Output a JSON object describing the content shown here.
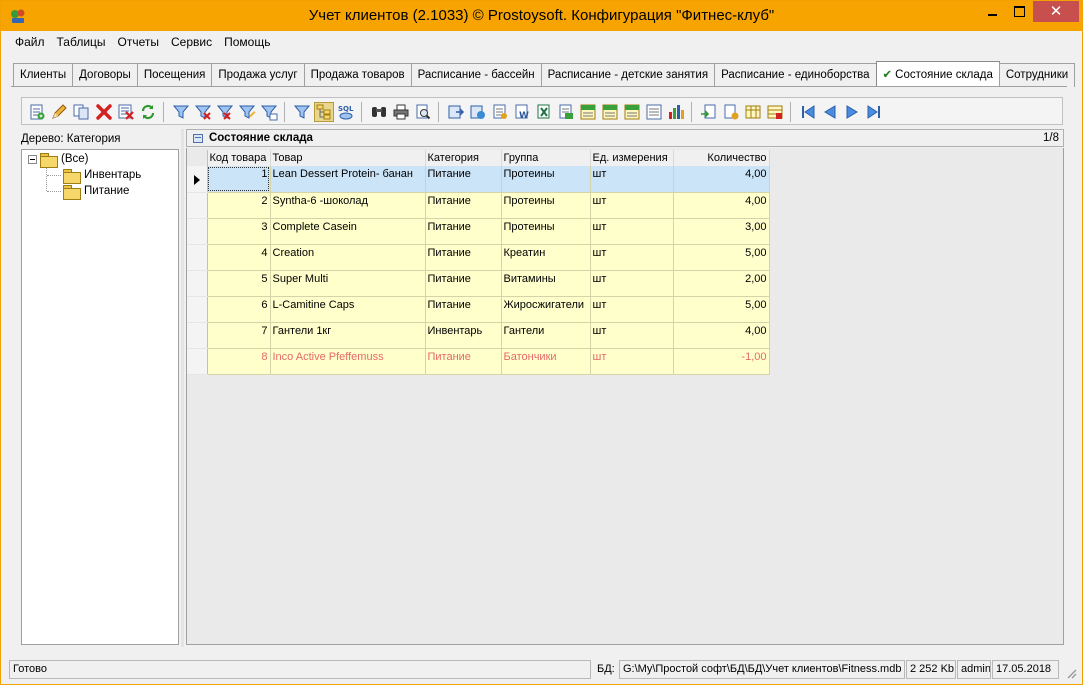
{
  "window": {
    "title": "Учет клиентов (2.1033) © Prostoysoft. Конфигурация \"Фитнес-клуб\"",
    "accent": "#f7a400",
    "close_glyph": "✕"
  },
  "menu": [
    "Файл",
    "Таблицы",
    "Отчеты",
    "Сервис",
    "Помощь"
  ],
  "tabs": [
    {
      "label": "Клиенты",
      "active": false
    },
    {
      "label": "Договоры",
      "active": false
    },
    {
      "label": "Посещения",
      "active": false
    },
    {
      "label": "Продажа услуг",
      "active": false
    },
    {
      "label": "Продажа товаров",
      "active": false
    },
    {
      "label": "Расписание - бассейн",
      "active": false
    },
    {
      "label": "Расписание - детские занятия",
      "active": false
    },
    {
      "label": "Расписание - единоборства",
      "active": false
    },
    {
      "label": "Состояние склада",
      "active": true
    },
    {
      "label": "Сотрудники",
      "active": false
    }
  ],
  "toolbar": {
    "icons": [
      "new-record-icon",
      "edit-icon",
      "copy-icon",
      "delete-icon",
      "delete-all-icon",
      "refresh-icon",
      "filter-icon",
      "filter-remove-icon",
      "filter-clear-icon",
      "filter-edit-icon",
      "filter-apply-icon",
      "view-filter-icon",
      "tree-view-icon",
      "sql-query-icon",
      "find-icon",
      "print-icon",
      "print-preview-icon",
      "export-icon",
      "export-html-icon",
      "export-rtf-icon",
      "export-word-icon",
      "export-excel-icon",
      "export-xml-icon",
      "export-txt-icon",
      "export-csv-icon",
      "export-dbf-icon",
      "chart-icon",
      "import-icon",
      "import-excel-icon",
      "columns-icon",
      "fields-icon",
      "first-record-icon",
      "prev-record-icon",
      "next-record-icon",
      "last-record-icon"
    ]
  },
  "tree": {
    "label": "Дерево: Категория",
    "root": "(Все)",
    "children": [
      "Инвентарь",
      "Питание"
    ]
  },
  "grid": {
    "title": "Состояние склада",
    "position": "1/8",
    "columns": [
      "Код товара",
      "Товар",
      "Категория",
      "Группа",
      "Ед. измерения",
      "Количество"
    ],
    "rows": [
      {
        "id": "1",
        "name": "Lean Dessert Protein- банан",
        "category": "Питание",
        "group": "Протеины",
        "unit": "шт",
        "qty": "4,00"
      },
      {
        "id": "2",
        "name": "Syntha-6 -шоколад",
        "category": "Питание",
        "group": "Протеины",
        "unit": "шт",
        "qty": "4,00"
      },
      {
        "id": "3",
        "name": "Complete Casein",
        "category": "Питание",
        "group": "Протеины",
        "unit": "шт",
        "qty": "3,00"
      },
      {
        "id": "4",
        "name": "Creation",
        "category": "Питание",
        "group": "Креатин",
        "unit": "шт",
        "qty": "5,00"
      },
      {
        "id": "5",
        "name": "Super Multi",
        "category": "Питание",
        "group": "Витамины",
        "unit": "шт",
        "qty": "2,00"
      },
      {
        "id": "6",
        "name": "L-Camitine Caps",
        "category": "Питание",
        "group": "Жиросжигатели",
        "unit": "шт",
        "qty": "5,00"
      },
      {
        "id": "7",
        "name": "Гантели 1кг",
        "category": "Инвентарь",
        "group": "Гантели",
        "unit": "шт",
        "qty": "4,00"
      },
      {
        "id": "8",
        "name": "Inco Active Pfeffemuss",
        "category": "Питание",
        "group": "Батончики",
        "unit": "шт",
        "qty": "-1,00"
      }
    ],
    "selected_row": 0,
    "row_color": "#ffffcc",
    "selected_color": "#cce4f7",
    "negative_color": "#e46a6a"
  },
  "status": {
    "state": "Готово",
    "db_label": "БД:",
    "db_path": "G:\\My\\Простой софт\\БД\\БД\\Учет клиентов\\Fitness.mdb",
    "db_size": "2 252 Kb",
    "user": "admin",
    "date": "17.05.2018"
  }
}
